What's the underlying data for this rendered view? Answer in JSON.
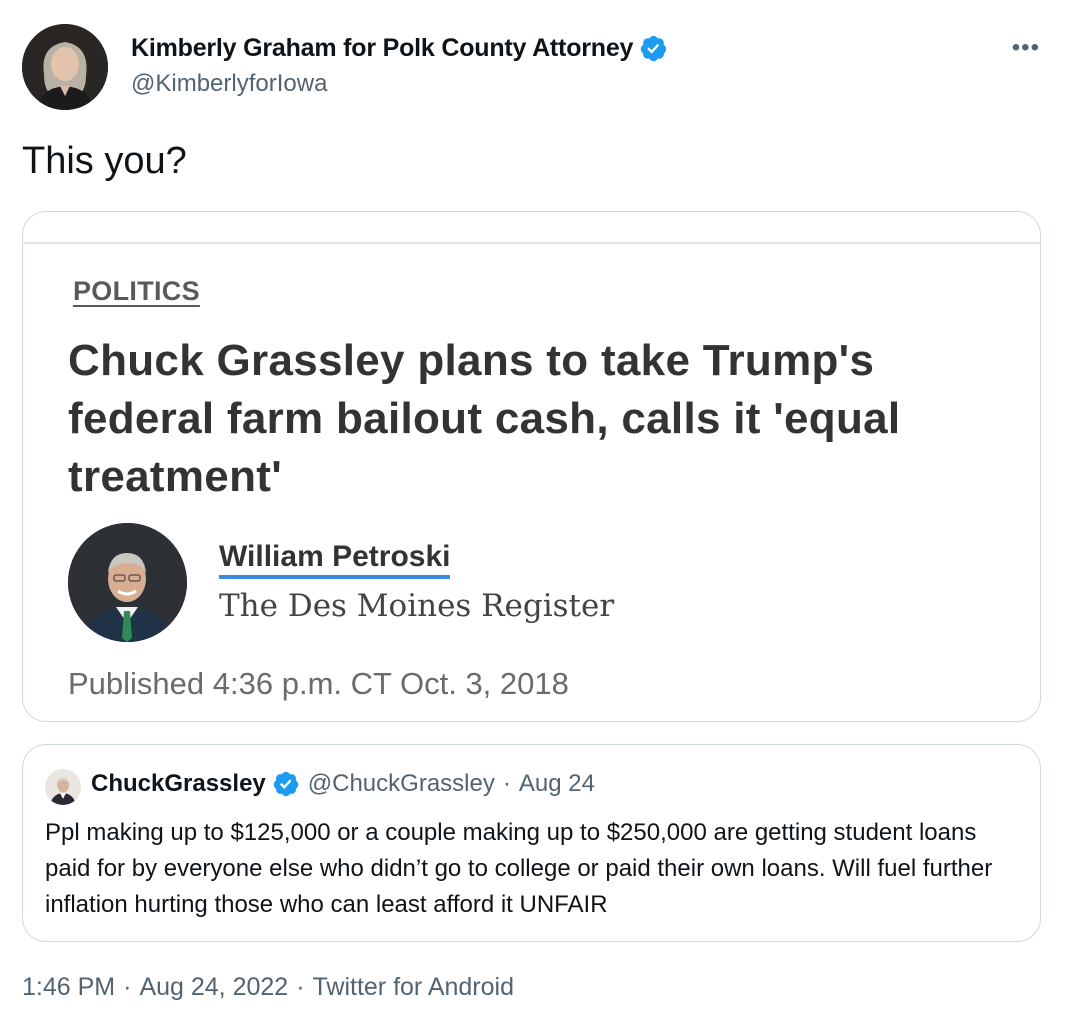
{
  "author": {
    "display_name": "Kimberly Graham for Polk County Attorney",
    "handle": "@KimberlyforIowa",
    "more_label": "•••"
  },
  "tweet": {
    "text": "This you?"
  },
  "article": {
    "section": "POLITICS",
    "headline": "Chuck Grassley plans to take Trump's federal farm bailout cash, calls it 'equal treatment'",
    "author_name": "William Petroski",
    "outlet": "The Des Moines Register",
    "published": "Published 4:36 p.m. CT Oct. 3, 2018"
  },
  "quoted": {
    "display_name": "ChuckGrassley",
    "handle": "@ChuckGrassley",
    "separator": "·",
    "time": "Aug 24",
    "text": "Ppl making up to $125,000 or a couple making up to $250,000 are getting student loans paid for by everyone else who didn’t go to college or paid their own loans. Will fuel further inflation hurting those who can least afford it UNFAIR"
  },
  "meta": {
    "time": "1:46 PM",
    "date": "Aug 24, 2022",
    "source": "Twitter for Android",
    "separator": "·"
  },
  "colors": {
    "verified_blue": "#1d9bf0",
    "secondary_text": "#536471",
    "border": "#cfd9de",
    "byline_underline": "#3d8bd8"
  },
  "icons": {
    "verified": "verified-badge-icon",
    "more": "more-options-icon"
  }
}
